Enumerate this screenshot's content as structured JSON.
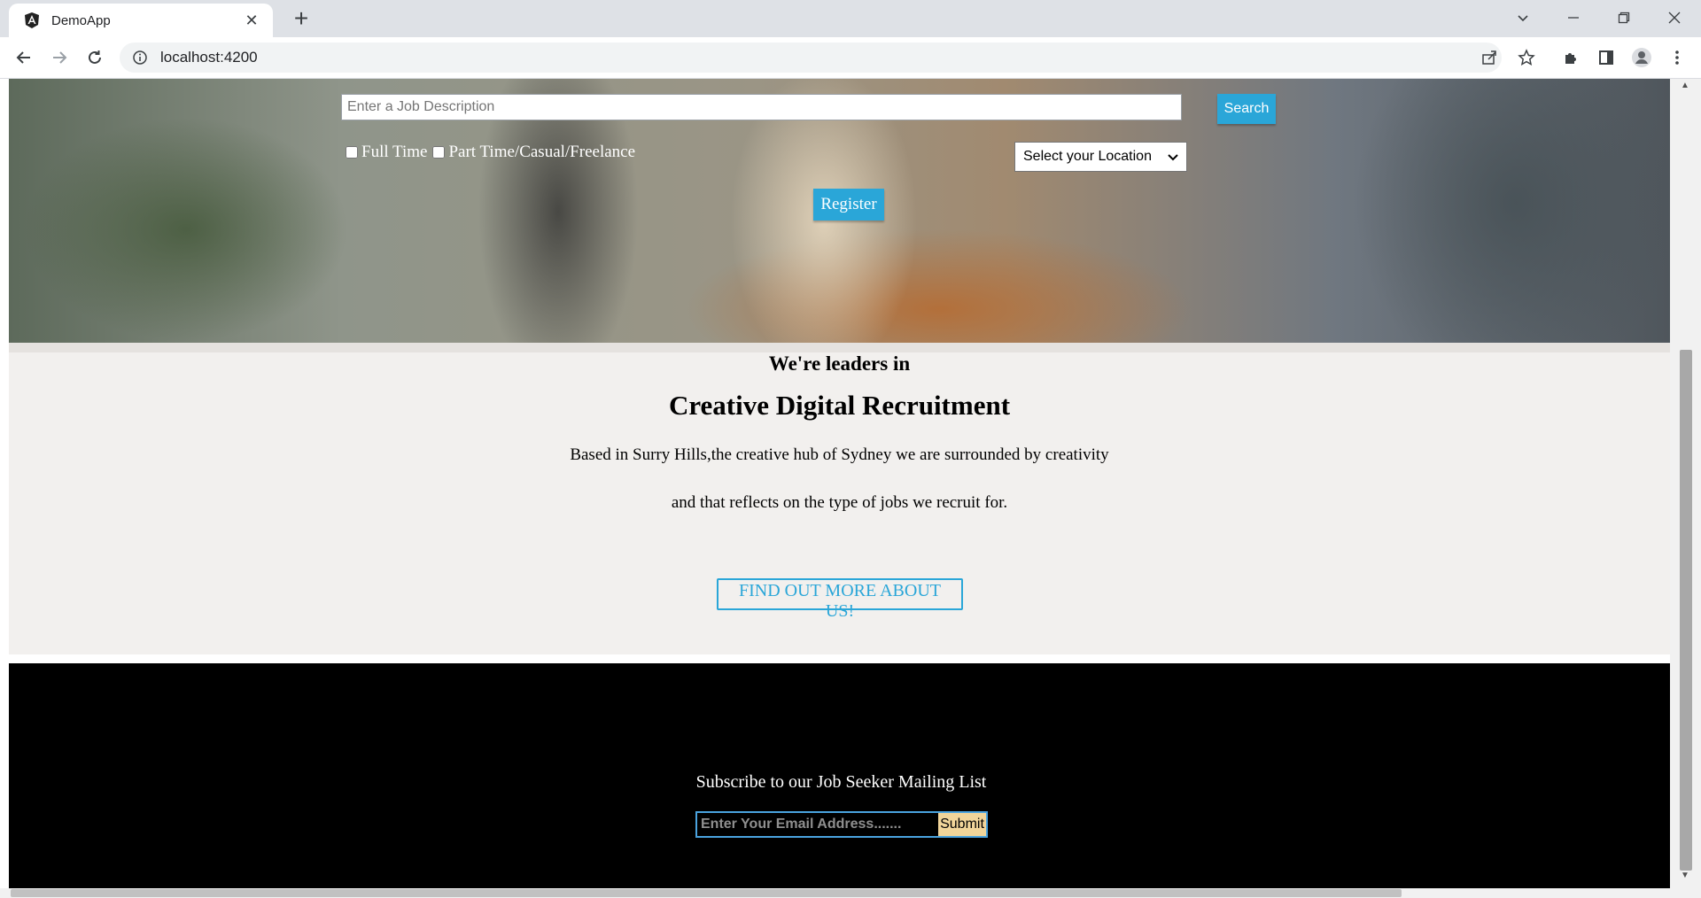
{
  "browser": {
    "tab_title": "DemoApp",
    "url": "localhost:4200"
  },
  "hero": {
    "job_placeholder": "Enter a Job Description",
    "search_label": "Search",
    "checkbox_full_time": "Full Time",
    "checkbox_part_time": "Part Time/Casual/Freelance",
    "location_selected": "Select your Location",
    "register_label": "Register"
  },
  "about": {
    "kicker": "We're leaders in",
    "heading": "Creative Digital Recruitment",
    "line1": "Based in Surry Hills,the creative hub of Sydney we are surrounded by creativity",
    "line2": "and that reflects on the type of jobs we recruit for.",
    "button_label": "FIND OUT MORE ABOUT US!"
  },
  "footer": {
    "subscribe_title": "Subscribe to our Job Seeker Mailing List",
    "email_placeholder": "Enter Your Email Address.......",
    "submit_label": "Submit"
  },
  "colors": {
    "accent": "#2aa6d8",
    "about_bg": "#f2f0ee",
    "footer_bg": "#000000",
    "submit_bg": "#f1d59a"
  }
}
